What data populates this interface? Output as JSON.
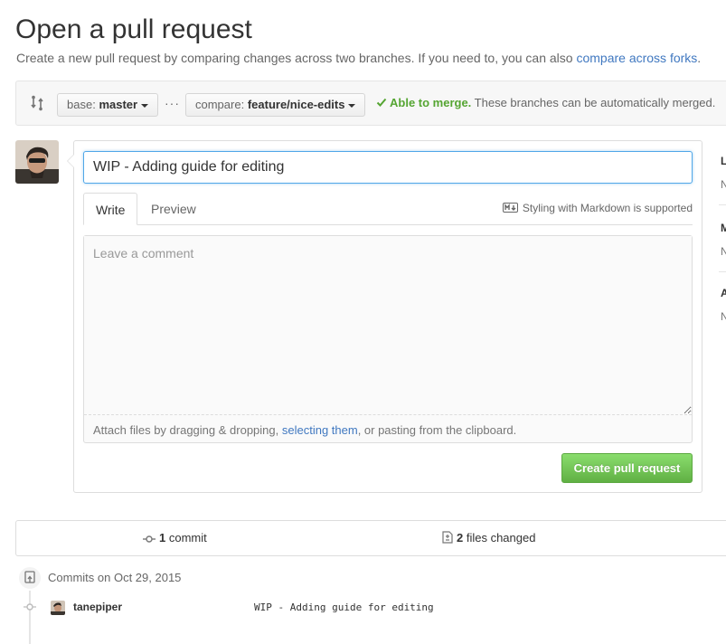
{
  "header": {
    "title": "Open a pull request",
    "subtitle_prefix": "Create a new pull request by comparing changes across two branches. If you need to, you can also ",
    "subtitle_link": "compare across forks",
    "subtitle_suffix": "."
  },
  "range": {
    "base_prefix": "base:",
    "base_branch": "master",
    "ellipsis": "···",
    "compare_prefix": "compare:",
    "compare_branch": "feature/nice-edits",
    "merge_ok": "Able to merge.",
    "merge_text": " These branches can be automatically merged.",
    "status_color": "#55a532"
  },
  "compose": {
    "title_value": "WIP - Adding guide for editing",
    "tabs": [
      "Write",
      "Preview"
    ],
    "markdown_hint": "Styling with Markdown is supported",
    "comment_placeholder": "Leave a comment",
    "attach_prefix": "Attach files by dragging & dropping, ",
    "attach_link": "selecting them",
    "attach_suffix": ", or pasting from the clipboard.",
    "submit_label": "Create pull request",
    "submit_color": "#60b044"
  },
  "sidebar": {
    "fragments": [
      {
        "heading": "L",
        "value": "N"
      },
      {
        "heading": "M",
        "value": "N"
      },
      {
        "heading": "A",
        "value": "N"
      }
    ]
  },
  "summary": {
    "commit_count": "1",
    "commit_label": " commit",
    "files_count": "2",
    "files_label": " files changed"
  },
  "commits": {
    "heading": "Commits on Oct 29, 2015",
    "items": [
      {
        "author": "tanepiper",
        "message": "WIP - Adding guide for editing"
      }
    ]
  },
  "icons": {
    "compare": "git-compare-icon",
    "check": "check-icon",
    "markdown": "markdown-icon",
    "commit": "git-commit-icon",
    "diff": "file-diff-icon",
    "commits_badge": "repo-push-icon"
  }
}
